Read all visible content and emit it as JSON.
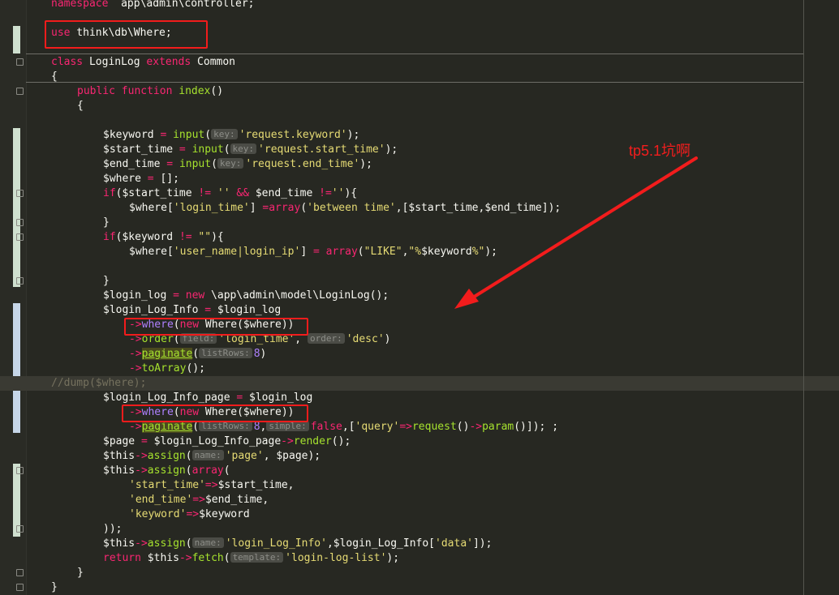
{
  "editor": {
    "lines": [
      {
        "i": 0,
        "t": [
          [
            "kw",
            "namespace"
          ],
          [
            "",
            "  app\\admin\\controller;"
          ]
        ]
      },
      {
        "i": 0,
        "t": []
      },
      {
        "i": 0,
        "t": [
          [
            "kw",
            "use"
          ],
          [
            "",
            " think\\db\\Where;"
          ]
        ]
      },
      {
        "i": 0,
        "t": []
      },
      {
        "i": 0,
        "t": [
          [
            "kw",
            "class"
          ],
          [
            "",
            " LoginLog "
          ],
          [
            "kw",
            "extends"
          ],
          [
            "",
            " Common"
          ]
        ]
      },
      {
        "i": 0,
        "t": [
          [
            "",
            "{"
          ]
        ]
      },
      {
        "i": 1,
        "t": [
          [
            "kw",
            "public"
          ],
          [
            "",
            " "
          ],
          [
            "kw",
            "function"
          ],
          [
            "",
            " "
          ],
          [
            "fn",
            "index"
          ],
          [
            "",
            "()"
          ]
        ]
      },
      {
        "i": 1,
        "t": [
          [
            "",
            "{"
          ]
        ]
      },
      {
        "i": 0,
        "t": []
      },
      {
        "i": 2,
        "t": [
          [
            "",
            "$keyword "
          ],
          [
            "op",
            "="
          ],
          [
            "",
            " "
          ],
          [
            "fn",
            "input"
          ],
          [
            "",
            "("
          ],
          [
            "hint",
            "key:"
          ],
          [
            "str",
            "'request.keyword'"
          ],
          [
            "",
            ");"
          ]
        ]
      },
      {
        "i": 2,
        "t": [
          [
            "",
            "$start_time "
          ],
          [
            "op",
            "="
          ],
          [
            "",
            " "
          ],
          [
            "fn",
            "input"
          ],
          [
            "",
            "("
          ],
          [
            "hint",
            "key:"
          ],
          [
            "str",
            "'request.start_time'"
          ],
          [
            "",
            ");"
          ]
        ]
      },
      {
        "i": 2,
        "t": [
          [
            "",
            "$end_time "
          ],
          [
            "op",
            "="
          ],
          [
            "",
            " "
          ],
          [
            "fn",
            "input"
          ],
          [
            "",
            "("
          ],
          [
            "hint",
            "key:"
          ],
          [
            "str",
            "'request.end_time'"
          ],
          [
            "",
            ");"
          ]
        ]
      },
      {
        "i": 2,
        "t": [
          [
            "",
            "$where "
          ],
          [
            "op",
            "="
          ],
          [
            "",
            " [];"
          ]
        ]
      },
      {
        "i": 2,
        "t": [
          [
            "kw",
            "if"
          ],
          [
            "",
            "($start_time "
          ],
          [
            "op",
            "!="
          ],
          [
            "",
            " "
          ],
          [
            "str",
            "''"
          ],
          [
            "",
            " "
          ],
          [
            "op",
            "&&"
          ],
          [
            "",
            " $end_time "
          ],
          [
            "op",
            "!="
          ],
          [
            "str",
            "''"
          ],
          [
            "",
            "){"
          ]
        ]
      },
      {
        "i": 3,
        "t": [
          [
            "",
            "$where["
          ],
          [
            "str",
            "'login_time'"
          ],
          [
            "",
            "] "
          ],
          [
            "op",
            "="
          ],
          [
            "kw",
            "array"
          ],
          [
            "",
            "("
          ],
          [
            "str",
            "'between time'"
          ],
          [
            "",
            ",[$start_time,$end_time]);"
          ]
        ]
      },
      {
        "i": 2,
        "t": [
          [
            "",
            "}"
          ]
        ]
      },
      {
        "i": 2,
        "t": [
          [
            "kw",
            "if"
          ],
          [
            "",
            "($keyword "
          ],
          [
            "op",
            "!="
          ],
          [
            "",
            " "
          ],
          [
            "str",
            "\"\""
          ],
          [
            "",
            "){"
          ]
        ]
      },
      {
        "i": 3,
        "t": [
          [
            "",
            "$where["
          ],
          [
            "str",
            "'user_name|login_ip'"
          ],
          [
            "",
            "] "
          ],
          [
            "op",
            "="
          ],
          [
            "",
            " "
          ],
          [
            "kw",
            "array"
          ],
          [
            "",
            "("
          ],
          [
            "str",
            "\"LIKE\""
          ],
          [
            "",
            ","
          ],
          [
            "str",
            "\"%"
          ],
          [
            "",
            "$keyword"
          ],
          [
            "str",
            "%\""
          ],
          [
            "",
            ");"
          ]
        ]
      },
      {
        "i": 0,
        "t": []
      },
      {
        "i": 2,
        "t": [
          [
            "",
            "}"
          ]
        ]
      },
      {
        "i": 2,
        "t": [
          [
            "",
            "$login_log "
          ],
          [
            "op",
            "="
          ],
          [
            "",
            " "
          ],
          [
            "kw",
            "new"
          ],
          [
            "",
            " \\app\\admin\\model\\LoginLog();"
          ]
        ]
      },
      {
        "i": 2,
        "t": [
          [
            "",
            "$login_Log_Info "
          ],
          [
            "op",
            "="
          ],
          [
            "",
            " $login_log"
          ]
        ]
      },
      {
        "i": 3,
        "t": [
          [
            "op",
            "->"
          ],
          [
            "wh",
            "where"
          ],
          [
            "",
            "("
          ],
          [
            "kw",
            "new"
          ],
          [
            "",
            " Where($where))"
          ]
        ]
      },
      {
        "i": 3,
        "t": [
          [
            "op",
            "->"
          ],
          [
            "mth",
            "order"
          ],
          [
            "",
            "("
          ],
          [
            "hint",
            "field:"
          ],
          [
            "str",
            "'login_time'"
          ],
          [
            "",
            ", "
          ],
          [
            "hint",
            "order:"
          ],
          [
            "str",
            "'desc'"
          ],
          [
            "",
            ")"
          ]
        ]
      },
      {
        "i": 3,
        "t": [
          [
            "op",
            "->"
          ],
          [
            "mthh",
            "paginate"
          ],
          [
            "",
            "("
          ],
          [
            "hint",
            "listRows:"
          ],
          [
            "wh",
            "8"
          ],
          [
            "",
            ")"
          ]
        ]
      },
      {
        "i": 3,
        "t": [
          [
            "op",
            "->"
          ],
          [
            "mth",
            "toArray"
          ],
          [
            "",
            "();"
          ]
        ]
      },
      {
        "i": 0,
        "cls": "cursorline",
        "t": [
          [
            "cm",
            "//dump($where);"
          ]
        ]
      },
      {
        "i": 2,
        "t": [
          [
            "",
            "$login_Log_Info_page "
          ],
          [
            "op",
            "="
          ],
          [
            "",
            " $login_log"
          ]
        ]
      },
      {
        "i": 3,
        "t": [
          [
            "op",
            "->"
          ],
          [
            "wh",
            "where"
          ],
          [
            "",
            "("
          ],
          [
            "kw",
            "new"
          ],
          [
            "",
            " Where($where))"
          ]
        ]
      },
      {
        "i": 3,
        "t": [
          [
            "op",
            "->"
          ],
          [
            "mthh",
            "paginate"
          ],
          [
            "",
            "("
          ],
          [
            "hint",
            "listRows:"
          ],
          [
            "wh",
            "8"
          ],
          [
            "",
            ","
          ],
          [
            "hint",
            "simple:"
          ],
          [
            "kw",
            "false"
          ],
          [
            "",
            ",["
          ],
          [
            "str",
            "'query'"
          ],
          [
            "op",
            "=>"
          ],
          [
            "fn",
            "request"
          ],
          [
            "",
            "()"
          ],
          [
            "op",
            "->"
          ],
          [
            "fn",
            "param"
          ],
          [
            "",
            "()]); ;"
          ]
        ]
      },
      {
        "i": 2,
        "t": [
          [
            "",
            "$page "
          ],
          [
            "op",
            "="
          ],
          [
            "",
            " $login_Log_Info_page"
          ],
          [
            "op",
            "->"
          ],
          [
            "fn",
            "render"
          ],
          [
            "",
            "();"
          ]
        ]
      },
      {
        "i": 2,
        "t": [
          [
            "",
            "$this"
          ],
          [
            "op",
            "->"
          ],
          [
            "fn",
            "assign"
          ],
          [
            "",
            "("
          ],
          [
            "hint",
            "name:"
          ],
          [
            "str",
            "'page'"
          ],
          [
            "",
            ", $page);"
          ]
        ]
      },
      {
        "i": 2,
        "t": [
          [
            "",
            "$this"
          ],
          [
            "op",
            "->"
          ],
          [
            "fn",
            "assign"
          ],
          [
            "",
            "("
          ],
          [
            "kw",
            "array"
          ],
          [
            "",
            "("
          ]
        ]
      },
      {
        "i": 3,
        "t": [
          [
            "str",
            "'start_time'"
          ],
          [
            "op",
            "=>"
          ],
          [
            "",
            "$start_time,"
          ]
        ]
      },
      {
        "i": 3,
        "t": [
          [
            "str",
            "'end_time'"
          ],
          [
            "op",
            "=>"
          ],
          [
            "",
            "$end_time,"
          ]
        ]
      },
      {
        "i": 3,
        "t": [
          [
            "str",
            "'keyword'"
          ],
          [
            "op",
            "=>"
          ],
          [
            "",
            "$keyword"
          ]
        ]
      },
      {
        "i": 2,
        "t": [
          [
            "",
            "));"
          ]
        ]
      },
      {
        "i": 2,
        "t": [
          [
            "",
            "$this"
          ],
          [
            "op",
            "->"
          ],
          [
            "fn",
            "assign"
          ],
          [
            "",
            "("
          ],
          [
            "hint",
            "name:"
          ],
          [
            "str",
            "'login_Log_Info'"
          ],
          [
            "",
            ",$login_Log_Info["
          ],
          [
            "str",
            "'data'"
          ],
          [
            "",
            "]);"
          ]
        ]
      },
      {
        "i": 2,
        "t": [
          [
            "kw",
            "return"
          ],
          [
            "",
            " $this"
          ],
          [
            "op",
            "->"
          ],
          [
            "fn",
            "fetch"
          ],
          [
            "",
            "("
          ],
          [
            "hint",
            "template:"
          ],
          [
            "str",
            "'login-log-list'"
          ],
          [
            "",
            ");"
          ]
        ]
      },
      {
        "i": 1,
        "t": [
          [
            "",
            "}"
          ]
        ]
      },
      {
        "i": 0,
        "t": [
          [
            "",
            "}"
          ]
        ]
      }
    ]
  },
  "annotation": {
    "label": "tp5.1坑啊"
  },
  "colors": {
    "background": "#272822",
    "annotation_red": "#f21c1c"
  }
}
